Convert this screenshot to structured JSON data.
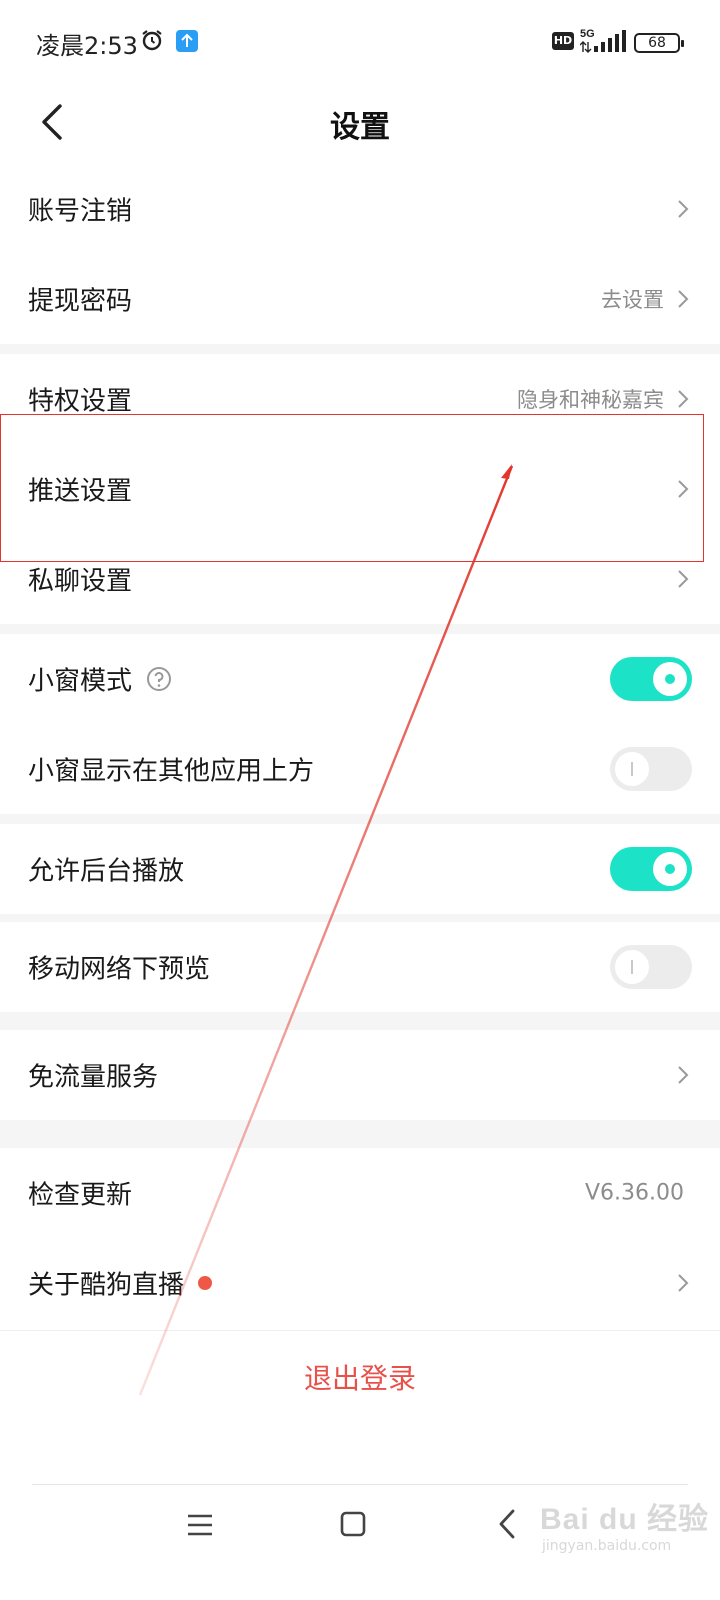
{
  "status_bar": {
    "time": "凌晨2:53",
    "hd": "HD",
    "network": "5G",
    "battery": "68"
  },
  "header": {
    "title": "设置"
  },
  "settings": {
    "account_cancel": {
      "label": "账号注销"
    },
    "withdraw_password": {
      "label": "提现密码",
      "value": "去设置"
    },
    "privilege": {
      "label": "特权设置",
      "value": "隐身和神秘嘉宾"
    },
    "push": {
      "label": "推送设置"
    },
    "private_chat": {
      "label": "私聊设置"
    },
    "mini_window": {
      "label": "小窗模式",
      "enabled": true
    },
    "mini_window_overlay": {
      "label": "小窗显示在其他应用上方",
      "enabled": false
    },
    "background_play": {
      "label": "允许后台播放",
      "enabled": true
    },
    "mobile_preview": {
      "label": "移动网络下预览",
      "enabled": false
    },
    "free_data": {
      "label": "免流量服务"
    },
    "check_update": {
      "label": "检查更新",
      "value": "V6.36.00"
    },
    "about": {
      "label": "关于酷狗直播"
    }
  },
  "logout": {
    "label": "退出登录"
  },
  "watermark": {
    "logo": "Bai du 经验",
    "url": "jingyan.baidu.com"
  },
  "colors": {
    "accent_toggle": "#1ce3c7",
    "logout_red": "#e8504a",
    "annotation_red": "#e2352b",
    "badge_red": "#ee5846"
  }
}
